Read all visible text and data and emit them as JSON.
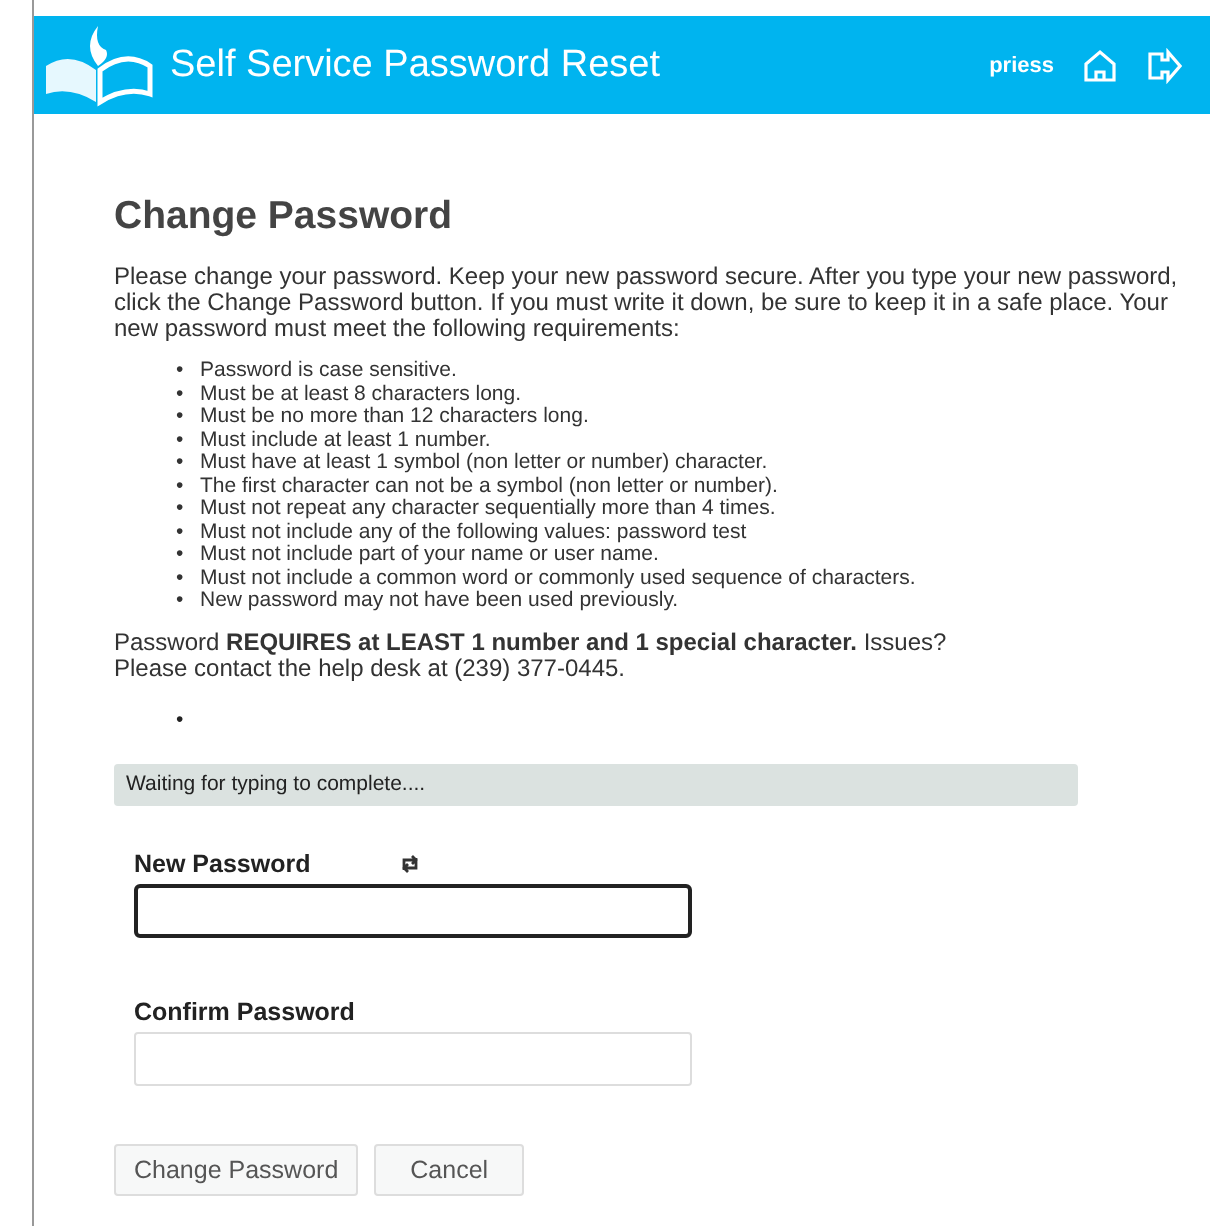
{
  "header": {
    "title": "Self Service Password Reset",
    "user": "priess"
  },
  "page_title": "Change Password",
  "intro": "Please change your password. Keep your new password secure. After you type your new password, click the Change Password button. If you must write it down, be sure to keep it in a safe place. Your new password must meet the following requirements:",
  "bullet": "•",
  "requirements": [
    "Password is case sensitive.",
    "Must be at least 8 characters long.",
    "Must be no more than 12 characters long.",
    "Must include at least 1 number.",
    "Must have at least 1 symbol (non letter or number) character.",
    "The first character can not be a symbol (non letter or number).",
    "Must not repeat any character sequentially more than 4 times.",
    "Must not include any of the following values: password test",
    "Must not include part of your name or user name.",
    "Must not include a common word or commonly used sequence of characters.",
    "New password may not have been used previously."
  ],
  "note": [
    "Password **REQUIRES at LEAST 1 number and 1 special character.** Issues?",
    "Please contact the help desk at (239) 377-0445."
  ],
  "status": "Waiting for typing to complete....",
  "fields": [
    {
      "label": "New Password",
      "focused": true,
      "kind": "with-toggle"
    },
    {
      "label": "Confirm Password",
      "focused": false,
      "kind": "plain"
    }
  ],
  "buttons": [
    "Change Password",
    "Cancel"
  ]
}
